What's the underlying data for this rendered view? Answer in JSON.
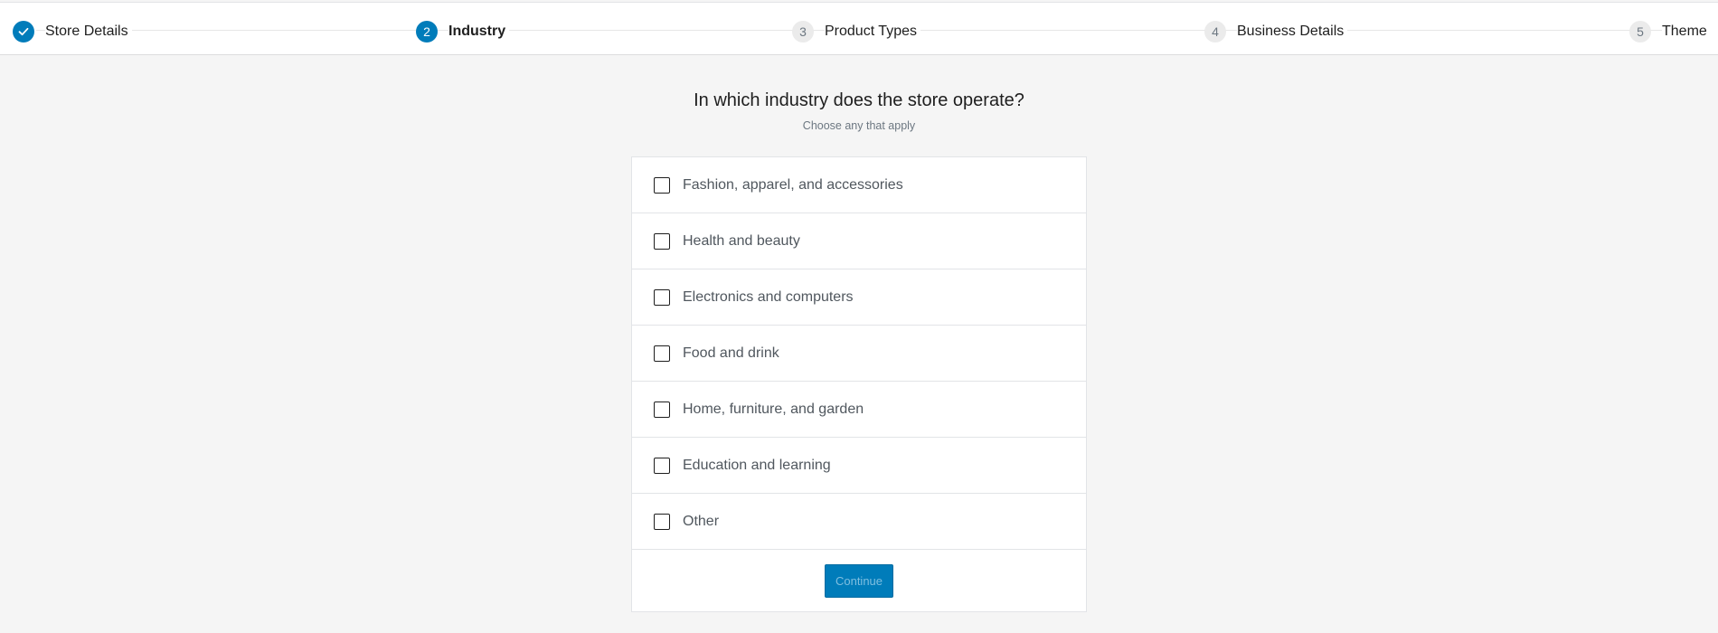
{
  "stepper": {
    "steps": [
      {
        "label": "Store Details",
        "badge": "",
        "state": "done",
        "icon": "check-icon"
      },
      {
        "label": "Industry",
        "badge": "2",
        "state": "active"
      },
      {
        "label": "Product Types",
        "badge": "3",
        "state": "pending"
      },
      {
        "label": "Business Details",
        "badge": "4",
        "state": "pending"
      },
      {
        "label": "Theme",
        "badge": "5",
        "state": "pending"
      }
    ]
  },
  "question": {
    "title": "In which industry does the store operate?",
    "subtitle": "Choose any that apply"
  },
  "options": [
    {
      "label": "Fashion, apparel, and accessories",
      "checked": false
    },
    {
      "label": "Health and beauty",
      "checked": false
    },
    {
      "label": "Electronics and computers",
      "checked": false
    },
    {
      "label": "Food and drink",
      "checked": false
    },
    {
      "label": "Home, furniture, and garden",
      "checked": false
    },
    {
      "label": "Education and learning",
      "checked": false
    },
    {
      "label": "Other",
      "checked": false
    }
  ],
  "actions": {
    "continue_label": "Continue"
  },
  "colors": {
    "accent": "#007cba",
    "background": "#f5f5f5"
  }
}
